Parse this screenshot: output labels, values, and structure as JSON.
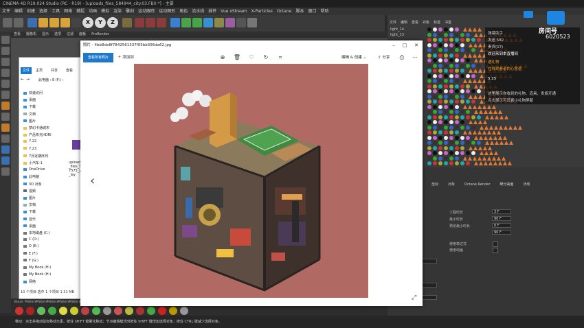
{
  "app": {
    "title": "CINEMA 4D R19.024 Studio (RC - R19) - [uploads_files_584944_city.03.FBX *] - 主要",
    "menu": [
      "文件",
      "编辑",
      "创建",
      "选择",
      "工具",
      "网格",
      "捕捉",
      "动画",
      "模拟",
      "渲染",
      "雕刻",
      "运动跟踪",
      "运动图形",
      "角色",
      "流水线",
      "插件",
      "Vue xStream",
      "X-Particles",
      "Octane",
      "脚本",
      "窗口",
      "帮助"
    ],
    "axes": [
      "X",
      "Y",
      "Z"
    ],
    "viewport_menu": [
      "查看",
      "摄像机",
      "显示",
      "选项",
      "过滤",
      "面板",
      "ProRender"
    ],
    "statusbar": "移动：点击并拖动鼠标移动元素。按住 SHIFT 键量化移动；节点编辑模式时按住 SHIFT 键增加选择对象；按住 CTRL 键减少选择对象。",
    "materials": [
      "Glass",
      "Matera",
      "Matera",
      "Matera",
      "Matera",
      "Matera",
      "Matera",
      "Matera"
    ]
  },
  "object_manager": {
    "tabs": [
      "文件",
      "编辑",
      "查看",
      "对象",
      "标签",
      "书签"
    ],
    "objects": [
      "light_14",
      "light_13"
    ]
  },
  "attributes": {
    "tabs": [
      "基本",
      "坐标",
      "对象",
      "Octane Render",
      "细分曲面",
      "法线"
    ],
    "fields": [
      {
        "label": "工程时长",
        "value": "3 F"
      },
      {
        "label": "最小时长",
        "value": "90 F"
      },
      {
        "label": "预览最小时长",
        "value": "0 F"
      },
      {
        "label": "",
        "value": "90 F"
      }
    ],
    "checks": [
      "使用表达式",
      "使用动画"
    ]
  },
  "stream_overlay": {
    "lines": [
      {
        "text": "弹幕助手",
        "color": "#cfcfcf"
      },
      {
        "text": "发送   582",
        "color": "#cfcfcf"
      },
      {
        "text": "贵宾(17)",
        "color": "#cfcfcf"
      },
      {
        "text": "欢迎来到本直播间",
        "color": "#ffffff"
      },
      {
        "text": "送礼物",
        "color": "#f0a020"
      },
      {
        "text": "在线观看者的心意值",
        "color": "#f0a020"
      },
      {
        "text": "5.25",
        "color": "#ffffff"
      },
      {
        "text": "这里展示你收到的礼物、道具、贵族开通",
        "color": "#cfcfcf"
      },
      {
        "text": "点击展示可设置小礼物屏蔽",
        "color": "#cfcfcf"
      }
    ],
    "watermark": {
      "name": "房间号",
      "number": "6020523"
    }
  },
  "explorer": {
    "ribbon_file": "文件",
    "ribbon_tabs": [
      "主页",
      "共享",
      "查看"
    ],
    "path": "此电脑 › E (F:) ›",
    "nav": [
      {
        "label": "快速访问",
        "icon": "star-icon",
        "color": "#3b8fd9"
      },
      {
        "label": "桌面",
        "icon": "folder-icon",
        "color": "#3b8fd9"
      },
      {
        "label": "下载",
        "icon": "download-icon",
        "color": "#3b8fd9"
      },
      {
        "label": "文档",
        "icon": "document-icon",
        "color": "#9aa"
      },
      {
        "label": "图片",
        "icon": "picture-icon",
        "color": "#3b8fd9"
      },
      {
        "label": "梦幻卡通城市",
        "icon": "folder-icon",
        "color": "#e8c34c"
      },
      {
        "label": "产品布光HDRI",
        "icon": "folder-icon",
        "color": "#e8c34c"
      },
      {
        "label": "7.22",
        "icon": "folder-icon",
        "color": "#e8c34c"
      },
      {
        "label": "7.23",
        "icon": "folder-icon",
        "color": "#e8c34c"
      },
      {
        "label": "7月近期序列",
        "icon": "folder-icon",
        "color": "#e8c34c"
      },
      {
        "label": "小汽车-1",
        "icon": "folder-icon",
        "color": "#e8c34c"
      },
      {
        "label": "OneDrive",
        "icon": "cloud-icon",
        "color": "#3b8fd9"
      },
      {
        "label": "此电脑",
        "icon": "computer-icon",
        "color": "#3b8fd9"
      },
      {
        "label": "3D 对象",
        "icon": "cube-icon",
        "color": "#3b8fd9"
      },
      {
        "label": "视频",
        "icon": "video-icon",
        "color": "#666"
      },
      {
        "label": "图片",
        "icon": "picture-icon",
        "color": "#3b8fd9"
      },
      {
        "label": "文档",
        "icon": "document-icon",
        "color": "#9aa"
      },
      {
        "label": "下载",
        "icon": "download-icon",
        "color": "#3b8fd9"
      },
      {
        "label": "音乐",
        "icon": "music-icon",
        "color": "#3b8fd9"
      },
      {
        "label": "桌面",
        "icon": "folder-icon",
        "color": "#3b8fd9"
      },
      {
        "label": "本地磁盘 (C:)",
        "icon": "drive-icon",
        "color": "#777"
      },
      {
        "label": "C (D:)",
        "icon": "drive-icon",
        "color": "#777"
      },
      {
        "label": "D (E:)",
        "icon": "drive-icon",
        "color": "#777"
      },
      {
        "label": "E (F:)",
        "icon": "drive-icon",
        "color": "#777"
      },
      {
        "label": "F (G:)",
        "icon": "drive-icon",
        "color": "#777"
      },
      {
        "label": "My Book (H:)",
        "icon": "drive-icon",
        "color": "#777"
      },
      {
        "label": "My Book (H:)",
        "icon": "drive-icon",
        "color": "#777"
      },
      {
        "label": "网络",
        "icon": "network-icon",
        "color": "#3b8fd9"
      }
    ],
    "file_name": "uploads_files_57575_y_lay",
    "status": "10 个项目   选中 1 个项目  1.31 MB"
  },
  "photos": {
    "title": "照片 - 4bb8de8f7842561337f05bb306da62.jpg",
    "see_all": "查看所有照片",
    "add_to": "添加到",
    "edit_create": "编辑 & 创建",
    "share": "分享",
    "image_bg": "#b06a63"
  }
}
